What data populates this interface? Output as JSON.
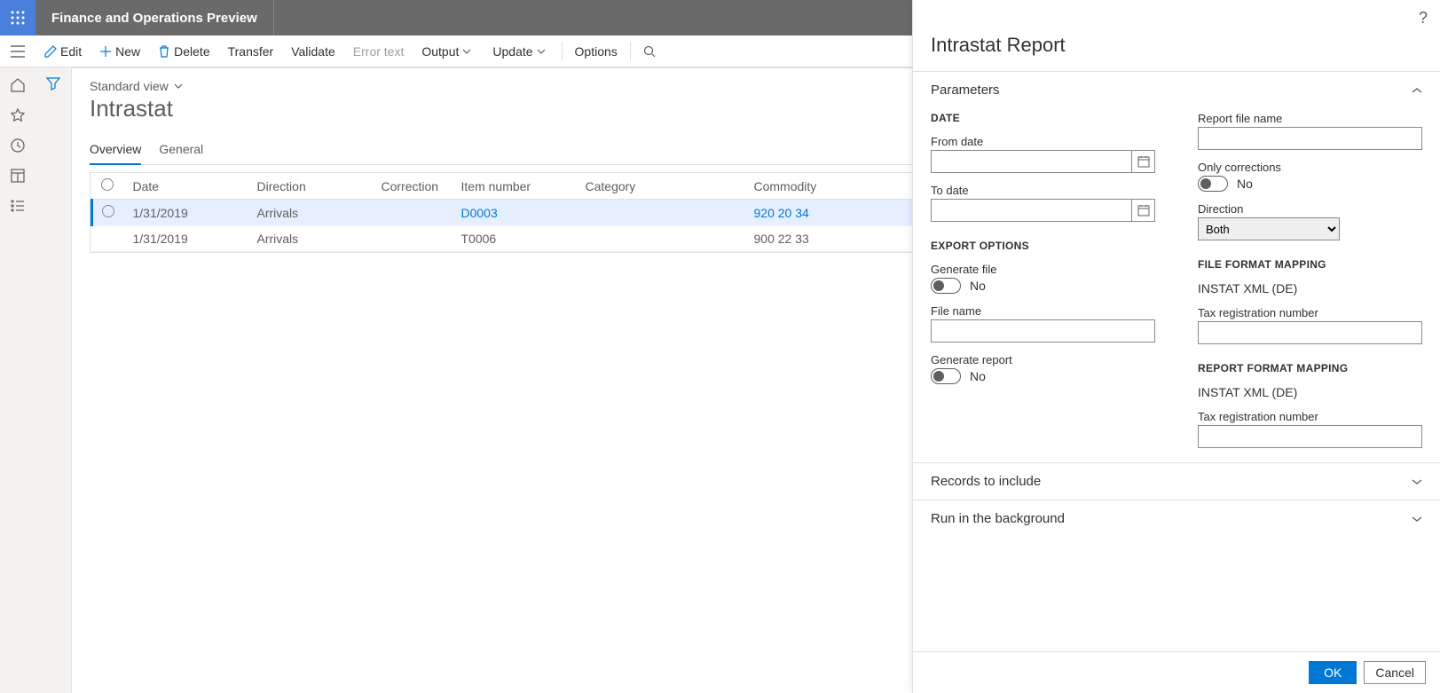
{
  "topbar": {
    "title": "Finance and Operations Preview"
  },
  "toolbar": {
    "edit": "Edit",
    "new": "New",
    "delete": "Delete",
    "transfer": "Transfer",
    "validate": "Validate",
    "error_text": "Error text",
    "output": "Output",
    "update": "Update",
    "options": "Options"
  },
  "page": {
    "view": "Standard view",
    "title": "Intrastat",
    "tabs": {
      "overview": "Overview",
      "general": "General"
    }
  },
  "grid": {
    "headers": {
      "date": "Date",
      "direction": "Direction",
      "correction": "Correction",
      "item_number": "Item number",
      "category": "Category",
      "commodity": "Commodity"
    },
    "rows": [
      {
        "date": "1/31/2019",
        "direction": "Arrivals",
        "correction": "",
        "item_number": "D0003",
        "category": "",
        "commodity": "920 20 34",
        "selected": true
      },
      {
        "date": "1/31/2019",
        "direction": "Arrivals",
        "correction": "",
        "item_number": "T0006",
        "category": "",
        "commodity": "900 22 33",
        "selected": false
      }
    ]
  },
  "panel": {
    "title": "Intrastat Report",
    "sections": {
      "parameters": "Parameters",
      "records": "Records to include",
      "background": "Run in the background"
    },
    "labels": {
      "date_group": "DATE",
      "from_date": "From date",
      "to_date": "To date",
      "export_group": "EXPORT OPTIONS",
      "generate_file": "Generate file",
      "file_name": "File name",
      "generate_report": "Generate report",
      "report_file_name": "Report file name",
      "only_corrections": "Only corrections",
      "direction": "Direction",
      "file_format_mapping": "FILE FORMAT MAPPING",
      "report_format_mapping": "REPORT FORMAT MAPPING",
      "tax_reg": "Tax registration number",
      "no": "No"
    },
    "values": {
      "direction_selected": "Both",
      "file_format_value": "INSTAT XML (DE)",
      "report_format_value": "INSTAT XML (DE)"
    },
    "buttons": {
      "ok": "OK",
      "cancel": "Cancel"
    }
  }
}
